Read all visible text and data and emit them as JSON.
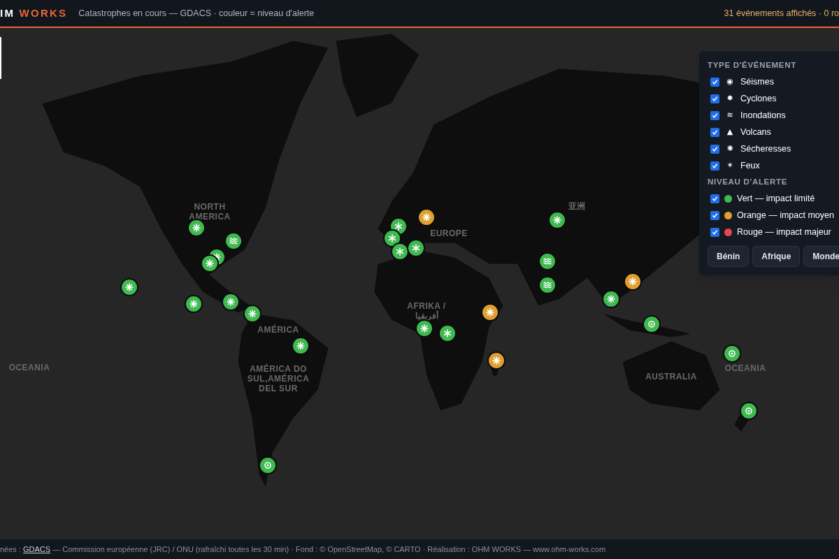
{
  "header": {
    "logo_prefix": "IM",
    "logo_suffix": "WORKS",
    "subtitle": "Catastrophes en cours — GDACS · couleur = niveau d'alerte",
    "summary": "31 événements affichés · 0 ro"
  },
  "map": {
    "labels": [
      {
        "text": "NORTH AMERICA"
      },
      {
        "text": "AMÉRICA"
      },
      {
        "text": "AMÉRICA DO SUL,AMÉRICA DEL SUR"
      },
      {
        "text": "EUROPE"
      },
      {
        "text": "AFRIKA / أفريقيا"
      },
      {
        "text": "亚洲"
      },
      {
        "text": "AUSTRALIA"
      },
      {
        "text": "OCEANIA"
      },
      {
        "text": "OCEANIA"
      }
    ],
    "markers": [
      {
        "kind": "cyclone",
        "color": "#3fb950"
      },
      {
        "kind": "flood",
        "color": "#3fb950"
      },
      {
        "kind": "cyclone",
        "color": "#3fb950"
      },
      {
        "kind": "cyclone",
        "color": "#3fb950"
      },
      {
        "kind": "cyclone",
        "color": "#3fb950"
      },
      {
        "kind": "cyclone",
        "color": "#3fb950"
      },
      {
        "kind": "cyclone",
        "color": "#3fb950"
      },
      {
        "kind": "cyclone",
        "color": "#3fb950"
      },
      {
        "kind": "cyclone",
        "color": "#3fb950"
      },
      {
        "kind": "earthquake",
        "color": "#3fb950"
      },
      {
        "kind": "cyclone",
        "color": "#e0a030"
      },
      {
        "kind": "fire",
        "color": "#3fb950"
      },
      {
        "kind": "fire",
        "color": "#3fb950"
      },
      {
        "kind": "fire",
        "color": "#3fb950"
      },
      {
        "kind": "fire",
        "color": "#3fb950"
      },
      {
        "kind": "cyclone",
        "color": "#3fb950"
      },
      {
        "kind": "fire",
        "color": "#3fb950"
      },
      {
        "kind": "cyclone",
        "color": "#e0a030"
      },
      {
        "kind": "cyclone",
        "color": "#e0a030"
      },
      {
        "kind": "cyclone",
        "color": "#3fb950"
      },
      {
        "kind": "flood",
        "color": "#3fb950"
      },
      {
        "kind": "flood",
        "color": "#3fb950"
      },
      {
        "kind": "cyclone",
        "color": "#3fb950"
      },
      {
        "kind": "cyclone",
        "color": "#e0a030"
      },
      {
        "kind": "earthquake",
        "color": "#3fb950"
      },
      {
        "kind": "earthquake",
        "color": "#3fb950"
      },
      {
        "kind": "earthquake",
        "color": "#3fb950"
      }
    ]
  },
  "legend": {
    "type_title": "TYPE D'ÉVÉNEMENT",
    "types": [
      {
        "icon": "◉",
        "label": "Séismes",
        "checked": true
      },
      {
        "icon": "✹",
        "label": "Cyclones",
        "checked": true
      },
      {
        "icon": "≋",
        "label": "Inondations",
        "checked": true
      },
      {
        "icon": "▲",
        "label": "Volcans",
        "checked": true
      },
      {
        "icon": "✺",
        "label": "Sécheresses",
        "checked": true
      },
      {
        "icon": "✶",
        "label": "Feux",
        "checked": true
      }
    ],
    "alert_title": "NIVEAU D'ALERTE",
    "alerts": [
      {
        "label": "Vert — impact limité",
        "color": "#3fb950",
        "checked": true
      },
      {
        "label": "Orange — impact moyen",
        "color": "#e0a030",
        "checked": true
      },
      {
        "label": "Rouge — impact majeur",
        "color": "#e5484d",
        "checked": true
      }
    ],
    "buttons": [
      "Bénin",
      "Afrique",
      "Monde"
    ]
  },
  "footer": {
    "prefix": "nées : ",
    "link": "GDACS",
    "suffix": " — Commission européenne (JRC) / ONU (rafraîchi toutes les 30 min) · Fond : © OpenStreetMap, © CARTO · Réalisation : OHM WORKS — www.ohm-works.com"
  }
}
